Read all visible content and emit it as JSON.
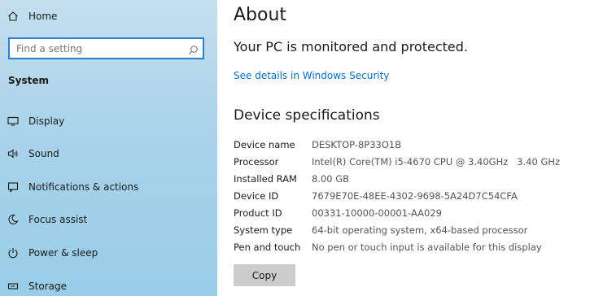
{
  "sidebar": {
    "home_label": "Home",
    "search_placeholder": "Find a setting",
    "section_label": "System",
    "items": [
      {
        "label": "Display",
        "icon": "display-icon"
      },
      {
        "label": "Sound",
        "icon": "sound-icon"
      },
      {
        "label": "Notifications & actions",
        "icon": "notifications-icon"
      },
      {
        "label": "Focus assist",
        "icon": "focus-assist-icon"
      },
      {
        "label": "Power & sleep",
        "icon": "power-icon"
      },
      {
        "label": "Storage",
        "icon": "storage-icon"
      }
    ]
  },
  "main": {
    "title": "About",
    "protection_status": "Your PC is monitored and protected.",
    "security_link": "See details in Windows Security",
    "specs_heading": "Device specifications",
    "specs": [
      {
        "label": "Device name",
        "value": "DESKTOP-8P33O1B"
      },
      {
        "label": "Processor",
        "value": "Intel(R) Core(TM) i5-4670 CPU @ 3.40GHz   3.40 GHz"
      },
      {
        "label": "Installed RAM",
        "value": "8.00 GB"
      },
      {
        "label": "Device ID",
        "value": "7679E70E-48EE-4302-9698-5A24D7C54CFA"
      },
      {
        "label": "Product ID",
        "value": "00331-10000-00001-AA029"
      },
      {
        "label": "System type",
        "value": "64-bit operating system, x64-based processor"
      },
      {
        "label": "Pen and touch",
        "value": "No pen or touch input is available for this display"
      }
    ],
    "copy_label": "Copy"
  },
  "colors": {
    "sidebar_top": "#c4dfee",
    "sidebar_bottom": "#99cde8",
    "link": "#0a6cc1",
    "search_border": "#2a80d0",
    "button_bg": "#cccccc"
  }
}
